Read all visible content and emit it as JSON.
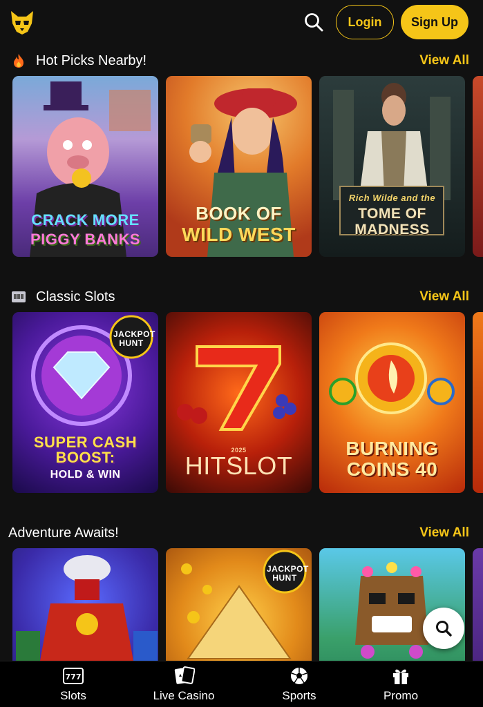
{
  "header": {
    "login_label": "Login",
    "signup_label": "Sign Up",
    "logo_icon": "wolf-mask-icon",
    "search_icon": "search-icon"
  },
  "sections": [
    {
      "title": "Hot Picks Nearby!",
      "icon": "fire-icon",
      "view_all": "View All",
      "games": [
        {
          "title_line1": "CRACK MORE",
          "title_line2": "PIGGY BANKS"
        },
        {
          "title_line1": "BOOK OF",
          "title_line2": "WILD WEST"
        },
        {
          "title_line1": "Rich Wilde and the",
          "title_line2": "TOME OF MADNESS"
        }
      ]
    },
    {
      "title": "Classic Slots",
      "icon": "slot-machine-icon",
      "view_all": "View All",
      "games": [
        {
          "badge": "JACKPOT HUNT",
          "title_line1": "SUPER CASH BOOST:",
          "title_line2": "HOLD & WIN"
        },
        {
          "title_line1": "2025",
          "title_line2": "HITSLOT"
        },
        {
          "title_line1": "BURNING",
          "title_line2": "COINS 40"
        }
      ]
    },
    {
      "title": "Adventure Awaits!",
      "view_all": "View All",
      "games": [
        {
          "title_line1": "",
          "title_line2": ""
        },
        {
          "badge": "JACKPOT HUNT"
        },
        {
          "title_line1": "",
          "title_line2": ""
        }
      ]
    }
  ],
  "nav": [
    {
      "label": "Slots",
      "icon": "slot-777-icon"
    },
    {
      "label": "Live Casino",
      "icon": "playing-cards-icon"
    },
    {
      "label": "Sports",
      "icon": "soccer-ball-icon"
    },
    {
      "label": "Promo",
      "icon": "gift-icon"
    }
  ],
  "colors": {
    "accent": "#f5c518",
    "background": "#111111",
    "nav_background": "#000000"
  }
}
